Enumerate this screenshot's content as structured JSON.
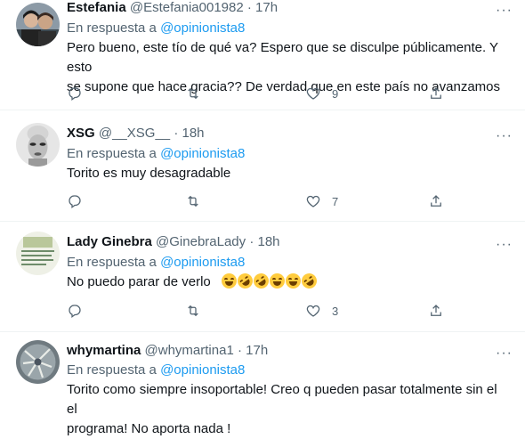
{
  "tweets": [
    {
      "name": "Estefania",
      "handle": "@Estefania001982",
      "dot": "·",
      "time": "17h",
      "reply_prefix": "En respuesta a",
      "reply_to": "@opinionista8",
      "text_line1": "Pero bueno, este tío de qué va? Espero que se disculpe públicamente. Y esto",
      "text_line2": "se supone que hace gracia?? De verdad que en este país no avanzamos",
      "likes": "9"
    },
    {
      "name": "XSG",
      "handle": "@__XSG__",
      "dot": "·",
      "time": "18h",
      "reply_prefix": "En respuesta a",
      "reply_to": "@opinionista8",
      "text_line1": "Torito es muy desagradable",
      "likes": "7"
    },
    {
      "name": "Lady Ginebra",
      "handle": "@GinebraLady",
      "dot": "·",
      "time": "18h",
      "reply_prefix": "En respuesta a",
      "reply_to": "@opinionista8",
      "text_line1": "No puedo parar de verlo",
      "emojis": [
        "face-with-tears-of-joy",
        "rofl",
        "rofl",
        "face-with-tears-of-joy",
        "face-with-tears-of-joy",
        "rofl"
      ],
      "likes": "3"
    },
    {
      "name": "whymartina",
      "handle": "@whymartina1",
      "dot": "·",
      "time": "17h",
      "reply_prefix": "En respuesta a",
      "reply_to": "@opinionista8",
      "text_line1": "Torito como siempre insoportable! Creo q  pueden pasar totalmente sin el el",
      "text_line2": "programa! No aporta nada !"
    }
  ],
  "more_glyph": "···",
  "colors": {
    "link": "#1d9bf0",
    "secondary": "#536471",
    "text": "#0f1419",
    "divider": "#eff3f4"
  }
}
